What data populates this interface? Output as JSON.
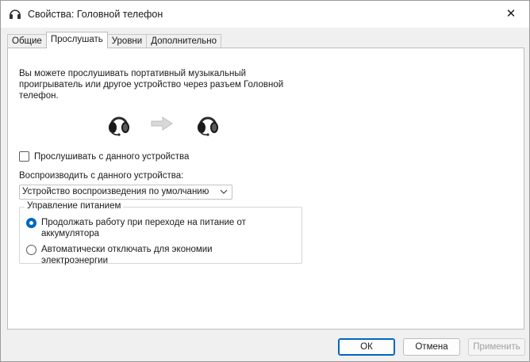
{
  "window": {
    "title": "Свойства: Головной телефон",
    "close_glyph": "✕"
  },
  "tabs": [
    {
      "label": "Общие"
    },
    {
      "label": "Прослушать"
    },
    {
      "label": "Уровни"
    },
    {
      "label": "Дополнительно"
    }
  ],
  "listen": {
    "description": "Вы можете прослушивать портативный музыкальный проигрыватель или другое устройство через разъем Головной телефон.",
    "listen_checkbox_label": "Прослушивать с данного устройства",
    "listen_checked": false,
    "playback_label": "Воспроизводить с данного устройства:",
    "playback_select_value": "Устройство воспроизведения по умолчанию",
    "icons": [
      "headset-icon",
      "arrow-right-icon",
      "headset-icon"
    ]
  },
  "power": {
    "group_title": "Управление питанием",
    "options": [
      {
        "label": "Продолжать работу при переходе на питание от аккумулятора",
        "selected": true
      },
      {
        "label": "Автоматически отключать для экономии электроэнергии",
        "selected": false
      }
    ]
  },
  "buttons": {
    "ok": "ОК",
    "cancel": "Отмена",
    "apply": "Применить"
  },
  "colors": {
    "accent": "#0067c0"
  }
}
